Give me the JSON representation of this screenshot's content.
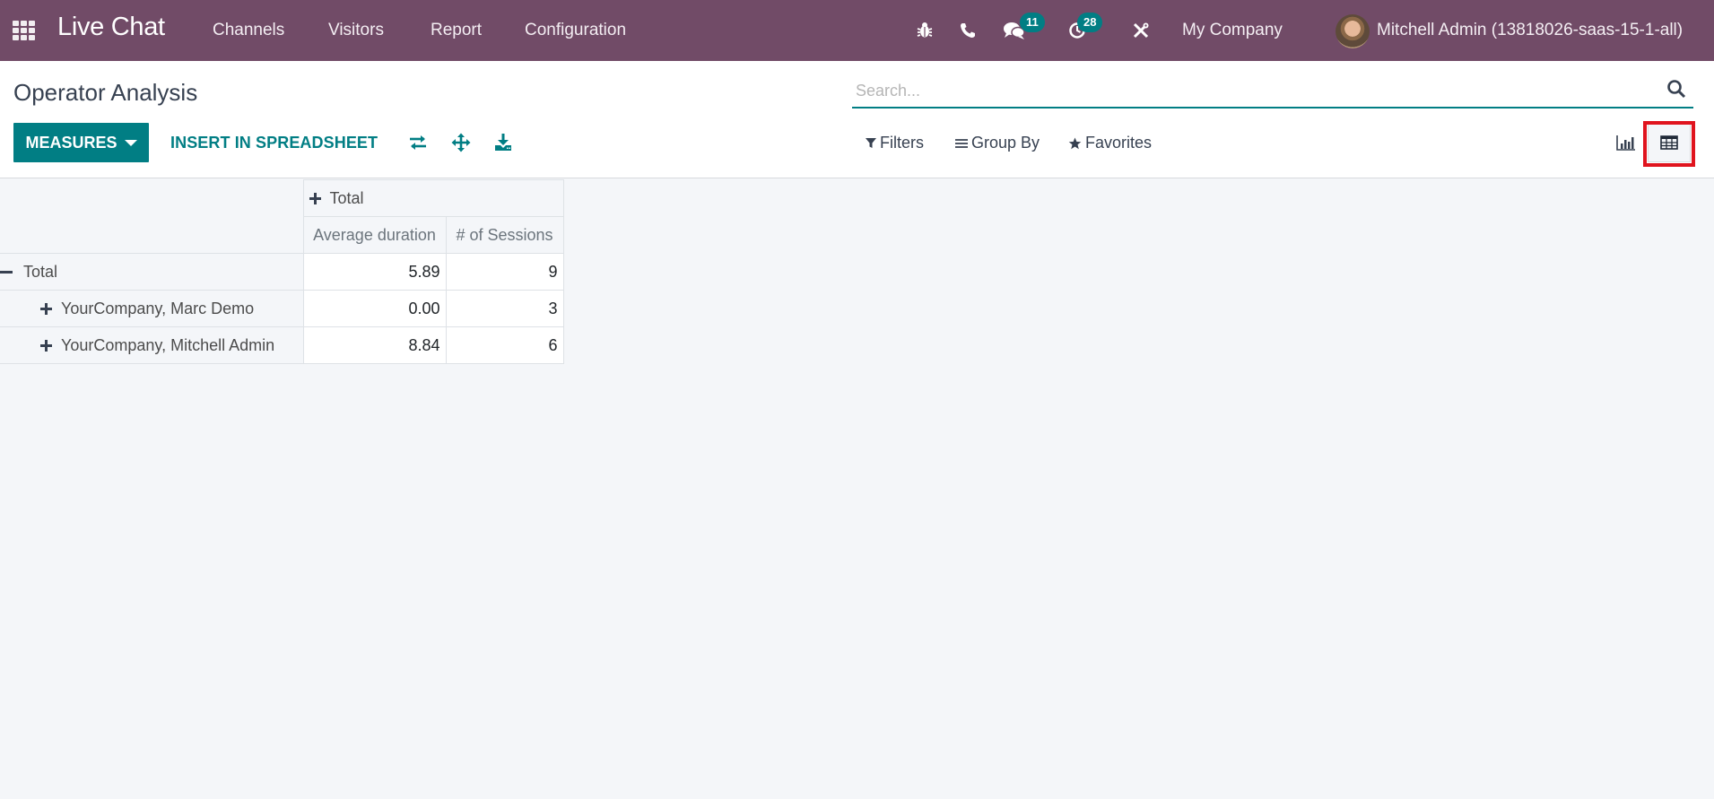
{
  "navbar": {
    "app_name": "Live Chat",
    "menu": [
      {
        "label": "Channels"
      },
      {
        "label": "Visitors"
      },
      {
        "label": "Report"
      },
      {
        "label": "Configuration"
      }
    ],
    "icons": {
      "apps": "apps-grid-icon",
      "debug": "bug-icon",
      "phone": "phone-icon",
      "messages": "chat-bubbles-icon",
      "activities": "clock-icon",
      "tools": "tools-icon"
    },
    "messages_badge": "11",
    "activities_badge": "28",
    "company": "My Company",
    "user": "Mitchell Admin (13818026-saas-15-1-all)",
    "color": "#714b67"
  },
  "control_panel": {
    "title": "Operator Analysis",
    "measures_label": "MEASURES",
    "insert_label": "INSERT IN SPREADSHEET",
    "tools": [
      "flip-axis-icon",
      "expand-all-icon",
      "download-icon"
    ],
    "search_placeholder": "Search...",
    "filters_label": "Filters",
    "groupby_label": "Group By",
    "favorites_label": "Favorites",
    "views": [
      {
        "name": "graph",
        "icon": "bar-chart-icon",
        "active": false
      },
      {
        "name": "pivot",
        "icon": "table-icon",
        "active": true
      }
    ],
    "accent_color": "#017e84",
    "highlight_color": "#e0141e"
  },
  "pivot": {
    "column_group": "Total",
    "measures": [
      "Average duration",
      "# of Sessions"
    ],
    "rows": [
      {
        "label": "Total",
        "expanded": true,
        "level": 0,
        "values": [
          "5.89",
          "9"
        ]
      },
      {
        "label": "YourCompany, Marc Demo",
        "expanded": false,
        "level": 1,
        "values": [
          "0.00",
          "3"
        ]
      },
      {
        "label": "YourCompany, Mitchell Admin",
        "expanded": false,
        "level": 1,
        "values": [
          "8.84",
          "6"
        ]
      }
    ]
  }
}
